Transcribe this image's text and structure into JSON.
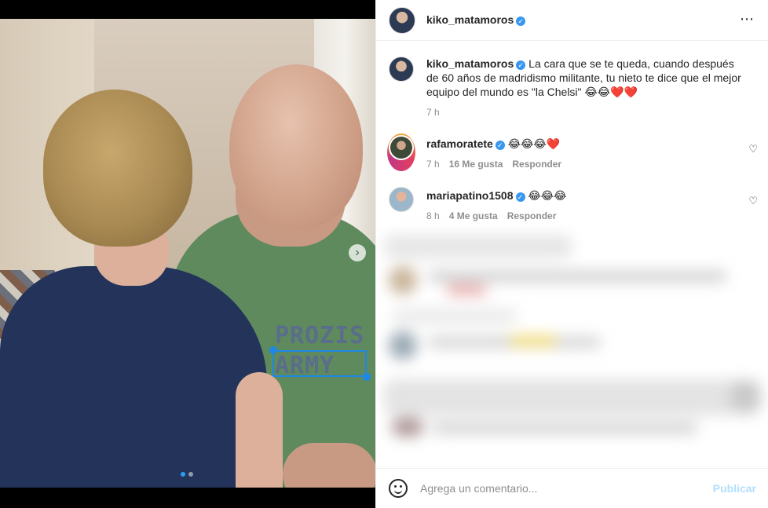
{
  "post": {
    "author": "kiko_matamoros",
    "more_icon": "⋯",
    "next_icon": "›",
    "carousel": {
      "count": 2,
      "active": 0
    },
    "image_text": {
      "line1": "PROZIS",
      "line2": "ARMY"
    }
  },
  "caption": {
    "username": "kiko_matamoros",
    "text": "La cara que se te queda, cuando después de 60 años de madridismo militante, tu nieto te dice que el mejor equipo del mundo es \"la Chelsi\" 😂😂❤️❤️",
    "time": "7 h"
  },
  "comments": [
    {
      "username": "rafamoratete",
      "text": "😂😂😂❤️",
      "time": "7 h",
      "likes": "16 Me gusta",
      "reply": "Responder",
      "heart_icon": "♡"
    },
    {
      "username": "mariapatino1508",
      "text": "😂😂😂",
      "time": "8 h",
      "likes": "4 Me gusta",
      "reply": "Responder",
      "heart_icon": "♡"
    }
  ],
  "composer": {
    "placeholder": "Agrega un comentario...",
    "submit": "Publicar"
  },
  "colors": {
    "verified": "#3897f0",
    "publish_disabled": "#b2dffc",
    "carousel_dot_active": "#2a9df4"
  }
}
